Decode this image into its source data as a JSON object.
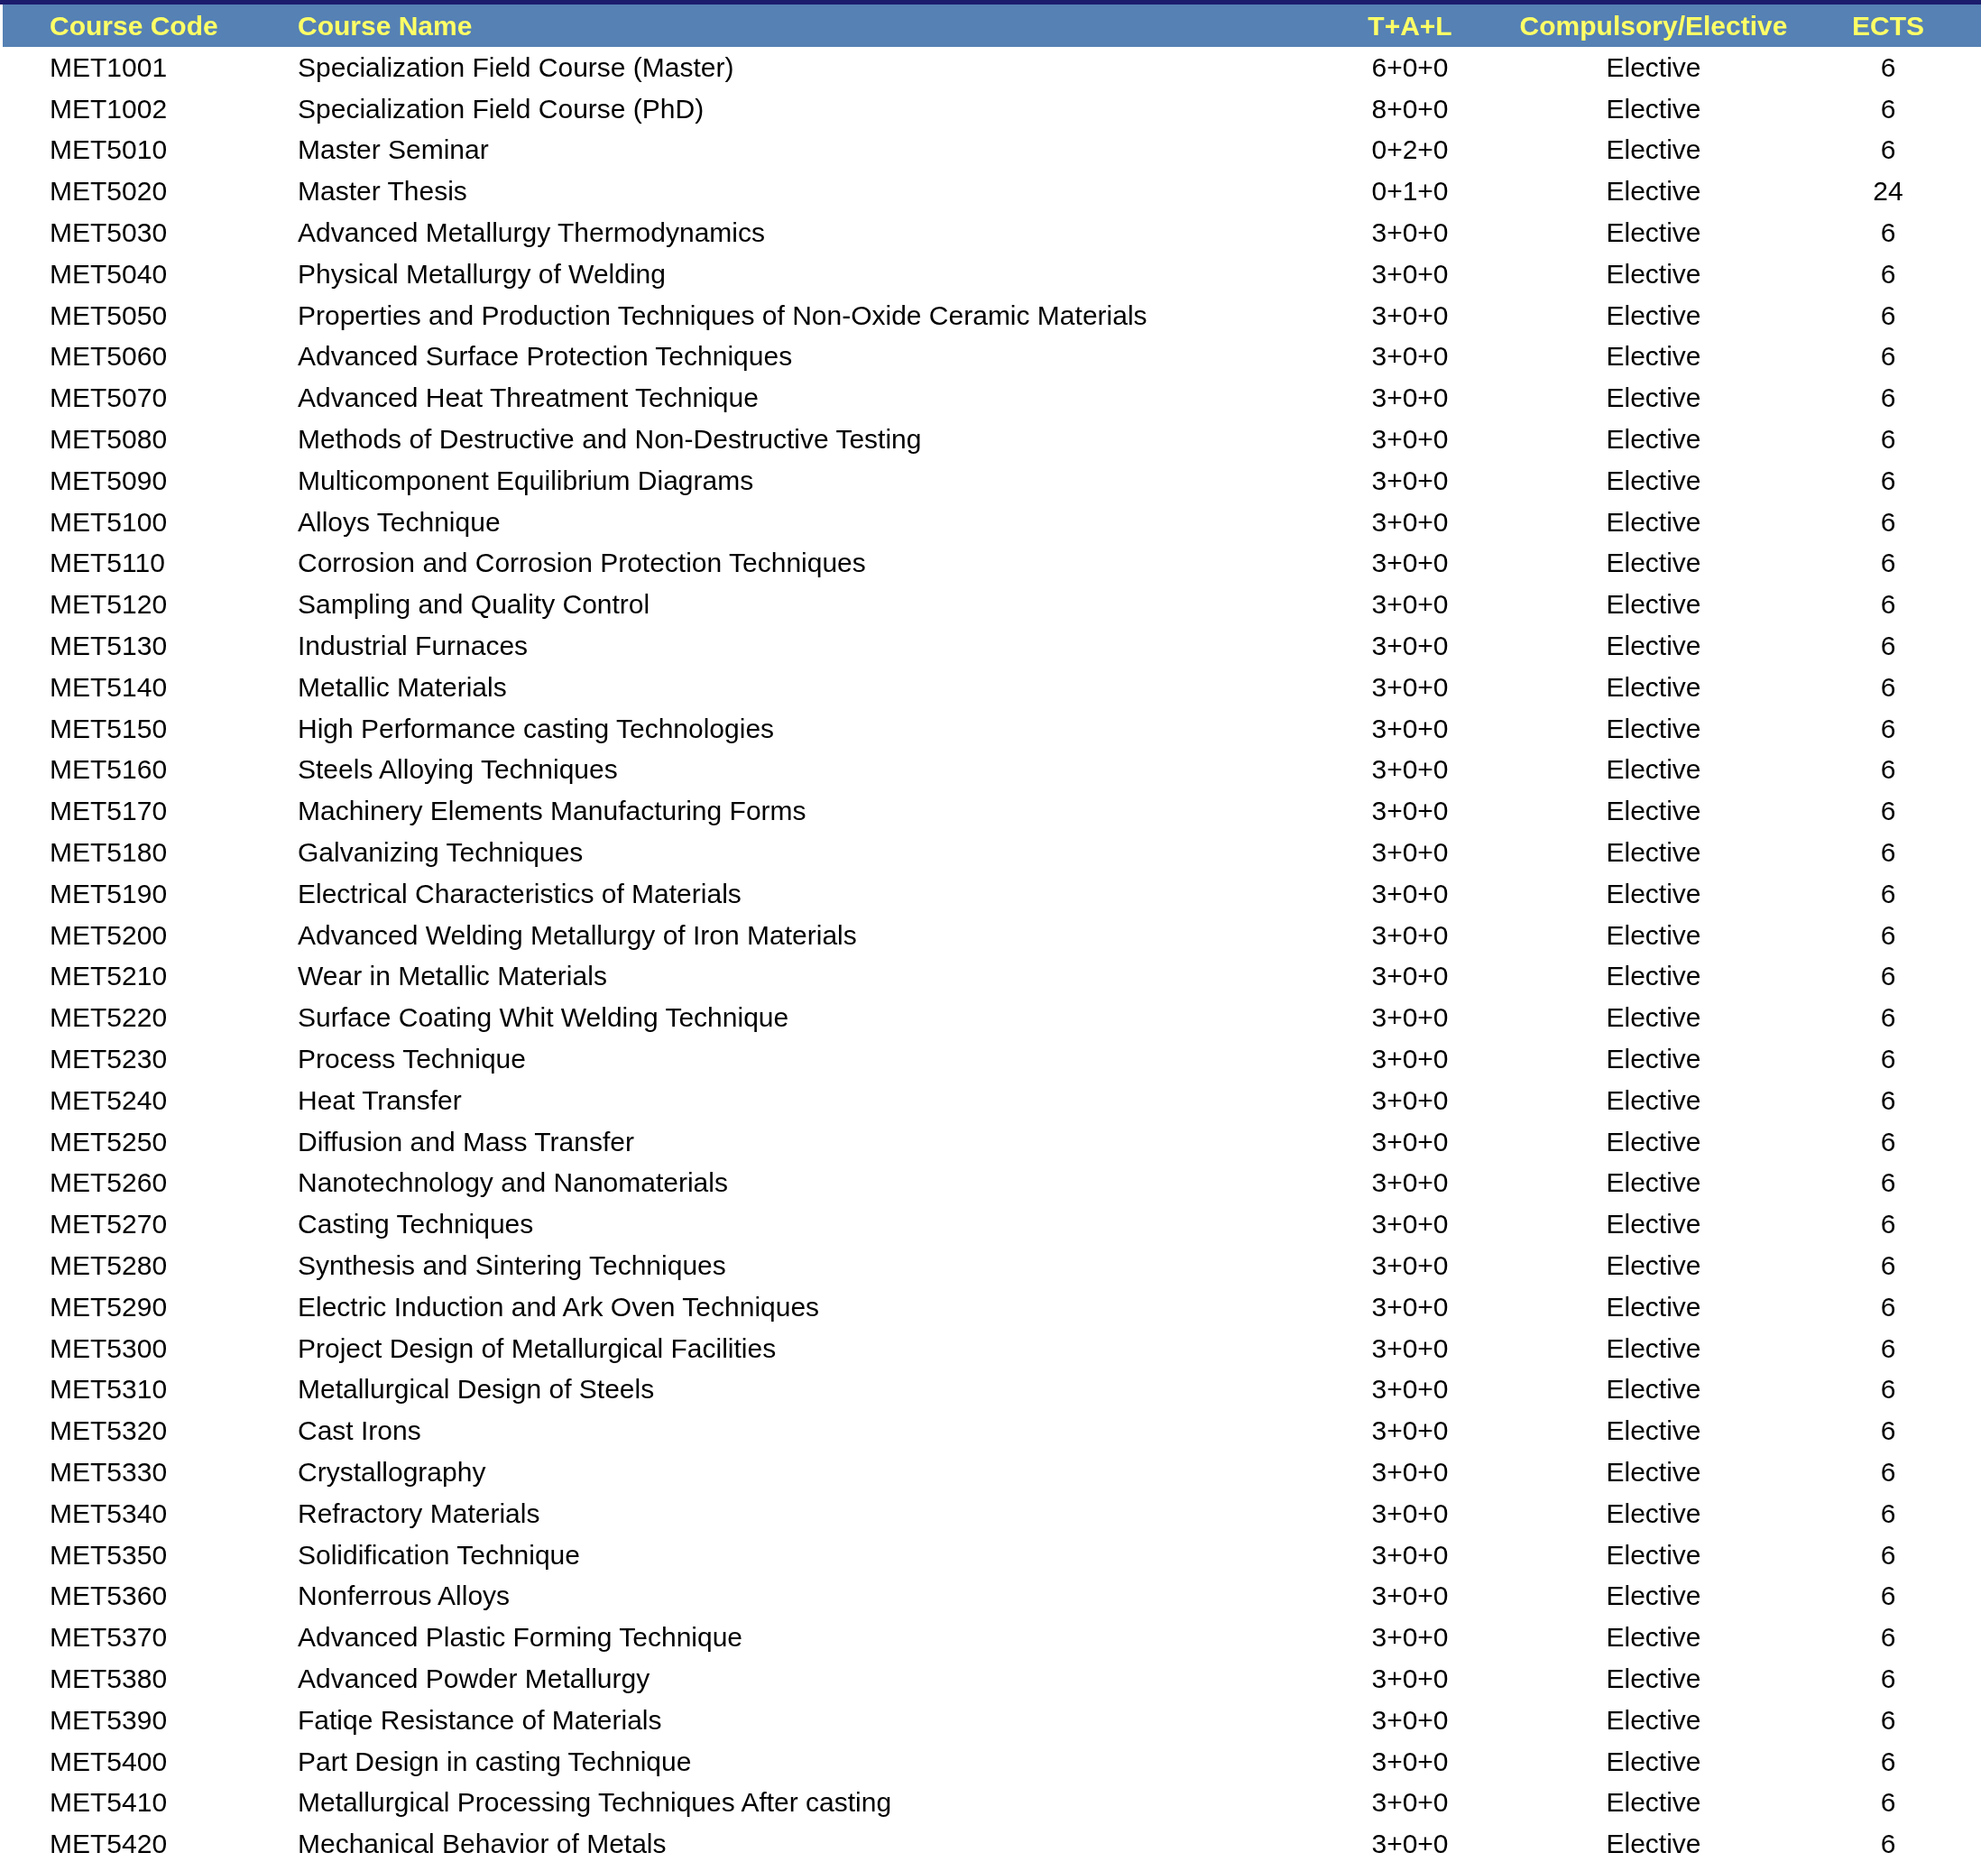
{
  "table": {
    "columns": [
      "Course Code",
      "Course Name",
      "T+A+L",
      "Compulsory/Elective",
      "ECTS"
    ],
    "rows": [
      [
        "MET1001",
        "Specialization Field Course (Master)",
        "6+0+0",
        "Elective",
        "6"
      ],
      [
        "MET1002",
        "Specialization Field Course (PhD)",
        "8+0+0",
        "Elective",
        "6"
      ],
      [
        "MET5010",
        "Master Seminar",
        "0+2+0",
        "Elective",
        "6"
      ],
      [
        "MET5020",
        "Master Thesis",
        "0+1+0",
        "Elective",
        "24"
      ],
      [
        "MET5030",
        "Advanced Metallurgy Thermodynamics",
        "3+0+0",
        "Elective",
        "6"
      ],
      [
        "MET5040",
        "Physical Metallurgy of Welding",
        "3+0+0",
        "Elective",
        "6"
      ],
      [
        "MET5050",
        "Properties and Production Techniques of Non-Oxide Ceramic Materials",
        "3+0+0",
        "Elective",
        "6"
      ],
      [
        "MET5060",
        "Advanced Surface Protection Techniques",
        "3+0+0",
        "Elective",
        "6"
      ],
      [
        "MET5070",
        "Advanced Heat Threatment Technique",
        "3+0+0",
        "Elective",
        "6"
      ],
      [
        "MET5080",
        "Methods of Destructive and Non-Destructive Testing",
        "3+0+0",
        "Elective",
        "6"
      ],
      [
        "MET5090",
        "Multicomponent Equilibrium Diagrams",
        "3+0+0",
        "Elective",
        "6"
      ],
      [
        "MET5100",
        "Alloys Technique",
        "3+0+0",
        "Elective",
        "6"
      ],
      [
        "MET5110",
        "Corrosion and Corrosion Protection Techniques",
        "3+0+0",
        "Elective",
        "6"
      ],
      [
        "MET5120",
        "Sampling and Quality Control",
        "3+0+0",
        "Elective",
        "6"
      ],
      [
        "MET5130",
        "Industrial Furnaces",
        "3+0+0",
        "Elective",
        "6"
      ],
      [
        "MET5140",
        "Metallic Materials",
        "3+0+0",
        "Elective",
        "6"
      ],
      [
        "MET5150",
        "High Performance casting Technologies",
        "3+0+0",
        "Elective",
        "6"
      ],
      [
        "MET5160",
        "Steels Alloying Techniques",
        "3+0+0",
        "Elective",
        "6"
      ],
      [
        "MET5170",
        "Machinery Elements Manufacturing Forms",
        "3+0+0",
        "Elective",
        "6"
      ],
      [
        "MET5180",
        "Galvanizing Techniques",
        "3+0+0",
        "Elective",
        "6"
      ],
      [
        "MET5190",
        "Electrical Characteristics of Materials",
        "3+0+0",
        "Elective",
        "6"
      ],
      [
        "MET5200",
        "Advanced Welding Metallurgy of Iron Materials",
        "3+0+0",
        "Elective",
        "6"
      ],
      [
        "MET5210",
        "Wear in Metallic Materials",
        "3+0+0",
        "Elective",
        "6"
      ],
      [
        "MET5220",
        "Surface Coating Whit Welding Technique",
        "3+0+0",
        "Elective",
        "6"
      ],
      [
        "MET5230",
        "Process Technique",
        "3+0+0",
        "Elective",
        "6"
      ],
      [
        "MET5240",
        "Heat Transfer",
        "3+0+0",
        "Elective",
        "6"
      ],
      [
        "MET5250",
        "Diffusion and Mass Transfer",
        "3+0+0",
        "Elective",
        "6"
      ],
      [
        "MET5260",
        "Nanotechnology and Nanomaterials",
        "3+0+0",
        "Elective",
        "6"
      ],
      [
        "MET5270",
        "Casting Techniques",
        "3+0+0",
        "Elective",
        "6"
      ],
      [
        "MET5280",
        "Synthesis and Sintering Techniques",
        "3+0+0",
        "Elective",
        "6"
      ],
      [
        "MET5290",
        "Electric Induction and Ark Oven Techniques",
        "3+0+0",
        "Elective",
        "6"
      ],
      [
        "MET5300",
        "Project Design of Metallurgical Facilities",
        "3+0+0",
        "Elective",
        "6"
      ],
      [
        "MET5310",
        "Metallurgical Design of Steels",
        "3+0+0",
        "Elective",
        "6"
      ],
      [
        "MET5320",
        "Cast Irons",
        "3+0+0",
        "Elective",
        "6"
      ],
      [
        "MET5330",
        "Crystallography",
        "3+0+0",
        "Elective",
        "6"
      ],
      [
        "MET5340",
        "Refractory Materials",
        "3+0+0",
        "Elective",
        "6"
      ],
      [
        "MET5350",
        "Solidification Technique",
        "3+0+0",
        "Elective",
        "6"
      ],
      [
        "MET5360",
        "Nonferrous Alloys",
        "3+0+0",
        "Elective",
        "6"
      ],
      [
        "MET5370",
        "Advanced Plastic Forming Technique",
        "3+0+0",
        "Elective",
        "6"
      ],
      [
        "MET5380",
        "Advanced Powder Metallurgy",
        "3+0+0",
        "Elective",
        "6"
      ],
      [
        "MET5390",
        "Fatiqe Resistance of Materials",
        "3+0+0",
        "Elective",
        "6"
      ],
      [
        "MET5400",
        "Part Design in casting Technique",
        "3+0+0",
        "Elective",
        "6"
      ],
      [
        "MET5410",
        "Metallurgical Processing Techniques After casting",
        "3+0+0",
        "Elective",
        "6"
      ],
      [
        "MET5420",
        "Mechanical Behavior of Metals",
        "3+0+0",
        "Elective",
        "6"
      ]
    ]
  }
}
